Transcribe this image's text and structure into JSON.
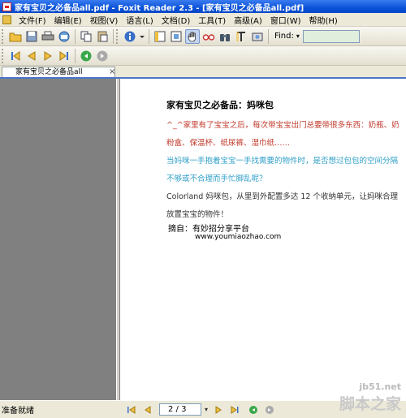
{
  "window": {
    "title": "家有宝贝之必备品all.pdf - Foxit Reader 2.3 - [家有宝贝之必备品all.pdf]"
  },
  "menu": {
    "items": [
      "文件(F)",
      "编辑(E)",
      "视图(V)",
      "语言(L)",
      "文档(D)",
      "工具(T)",
      "高级(A)",
      "窗口(W)",
      "帮助(H)"
    ]
  },
  "toolbar": {
    "find_label": "Find:",
    "find_value": ""
  },
  "tabs": [
    {
      "label": "家有宝贝之必备品all"
    }
  ],
  "document": {
    "title": "家有宝贝之必备品：妈咪包",
    "para_red": "^_^家里有了宝宝之后，每次带宝宝出门总要带很多东西：奶瓶、奶粉盒、保温杯、纸尿裤、湿巾纸……",
    "para_blue": "当妈咪一手抱着宝宝一手找需要的物件时，是否想过包包的空间分隔不够或不合理而手忙脚乱呢？",
    "para_dark": "Colorland 妈咪包，从里到外配置多达 12 个收纳单元，让妈咪合理放置宝宝的物件！",
    "source": "摘自：有妙招分享平台",
    "url": "www.youmiaozhao.com"
  },
  "statusbar": {
    "status": "准备就绪",
    "page": "2 / 3"
  },
  "watermark": {
    "domain": "jb51.net",
    "name": "脚本之家"
  },
  "colors": {
    "accent_red": "#c0392b",
    "accent_blue": "#2e9fc8",
    "titlebar": "#0a52d8"
  }
}
